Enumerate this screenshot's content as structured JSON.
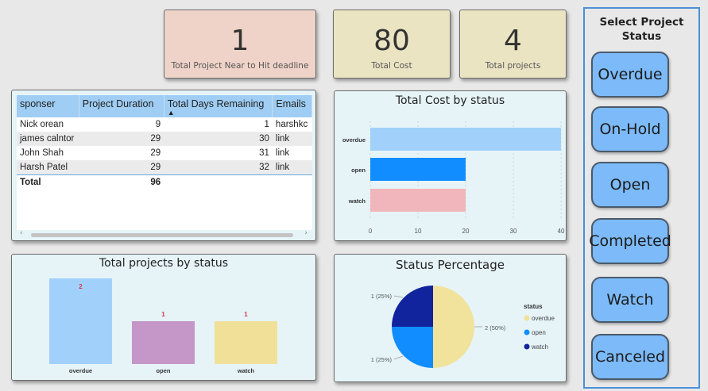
{
  "kpis": [
    {
      "value": "1",
      "label": "Total Project Near to Hit deadline"
    },
    {
      "value": "80",
      "label": "Total Cost"
    },
    {
      "value": "4",
      "label": "Total projects"
    }
  ],
  "table": {
    "columns": [
      "sponser",
      "Project Duration",
      "Total Days Remaining",
      "Emails"
    ],
    "rows": [
      {
        "sponser": "Nick orean",
        "duration": "9",
        "remaining": "1",
        "email": "harshkc"
      },
      {
        "sponser": "james calntor",
        "duration": "29",
        "remaining": "30",
        "email": "link"
      },
      {
        "sponser": "John Shah",
        "duration": "29",
        "remaining": "31",
        "email": "link"
      },
      {
        "sponser": "Harsh Patel",
        "duration": "29",
        "remaining": "32",
        "email": "link"
      }
    ],
    "total": {
      "label": "Total",
      "duration": "96"
    },
    "sort_column": "Total Days Remaining"
  },
  "cost_chart_title": "Total Cost by status",
  "projects_chart_title": "Total projects by status",
  "pie_chart_title": "Status Percentage",
  "slicer": {
    "title": "Select Project Status",
    "options": [
      "Overdue",
      "On-Hold",
      "Open",
      "Completed",
      "Watch",
      "Canceled"
    ]
  },
  "colors": {
    "overdue": "#a1d1fb",
    "open": "#118dff",
    "watch": "#f1b6bb",
    "bar_overdue": "#a1d1fb",
    "bar_open": "#c497c8",
    "bar_watch": "#f1e097",
    "pie_overdue": "#f1e29c",
    "pie_open": "#118dff",
    "pie_watch": "#12239e",
    "label_red": "#d63a4e"
  },
  "chart_data": [
    {
      "type": "bar",
      "orientation": "horizontal",
      "title": "Total Cost by status",
      "categories": [
        "overdue",
        "open",
        "watch"
      ],
      "values": [
        40,
        20,
        20
      ],
      "xlim": [
        0,
        40
      ],
      "xticks": [
        "0",
        "10",
        "20",
        "30",
        "40"
      ],
      "grid": true
    },
    {
      "type": "bar",
      "title": "Total projects by status",
      "categories": [
        "overdue",
        "open",
        "watch"
      ],
      "values": [
        2,
        1,
        1
      ],
      "data_labels": [
        "2",
        "1",
        "1"
      ]
    },
    {
      "type": "pie",
      "title": "Status Percentage",
      "legend_title": "status",
      "legend_placement": "right",
      "slices": [
        {
          "name": "overdue",
          "value": 2,
          "label": "2 (50%)"
        },
        {
          "name": "open",
          "value": 1,
          "label": "1 (25%)"
        },
        {
          "name": "watch",
          "value": 1,
          "label": "1 (25%)"
        }
      ]
    }
  ]
}
